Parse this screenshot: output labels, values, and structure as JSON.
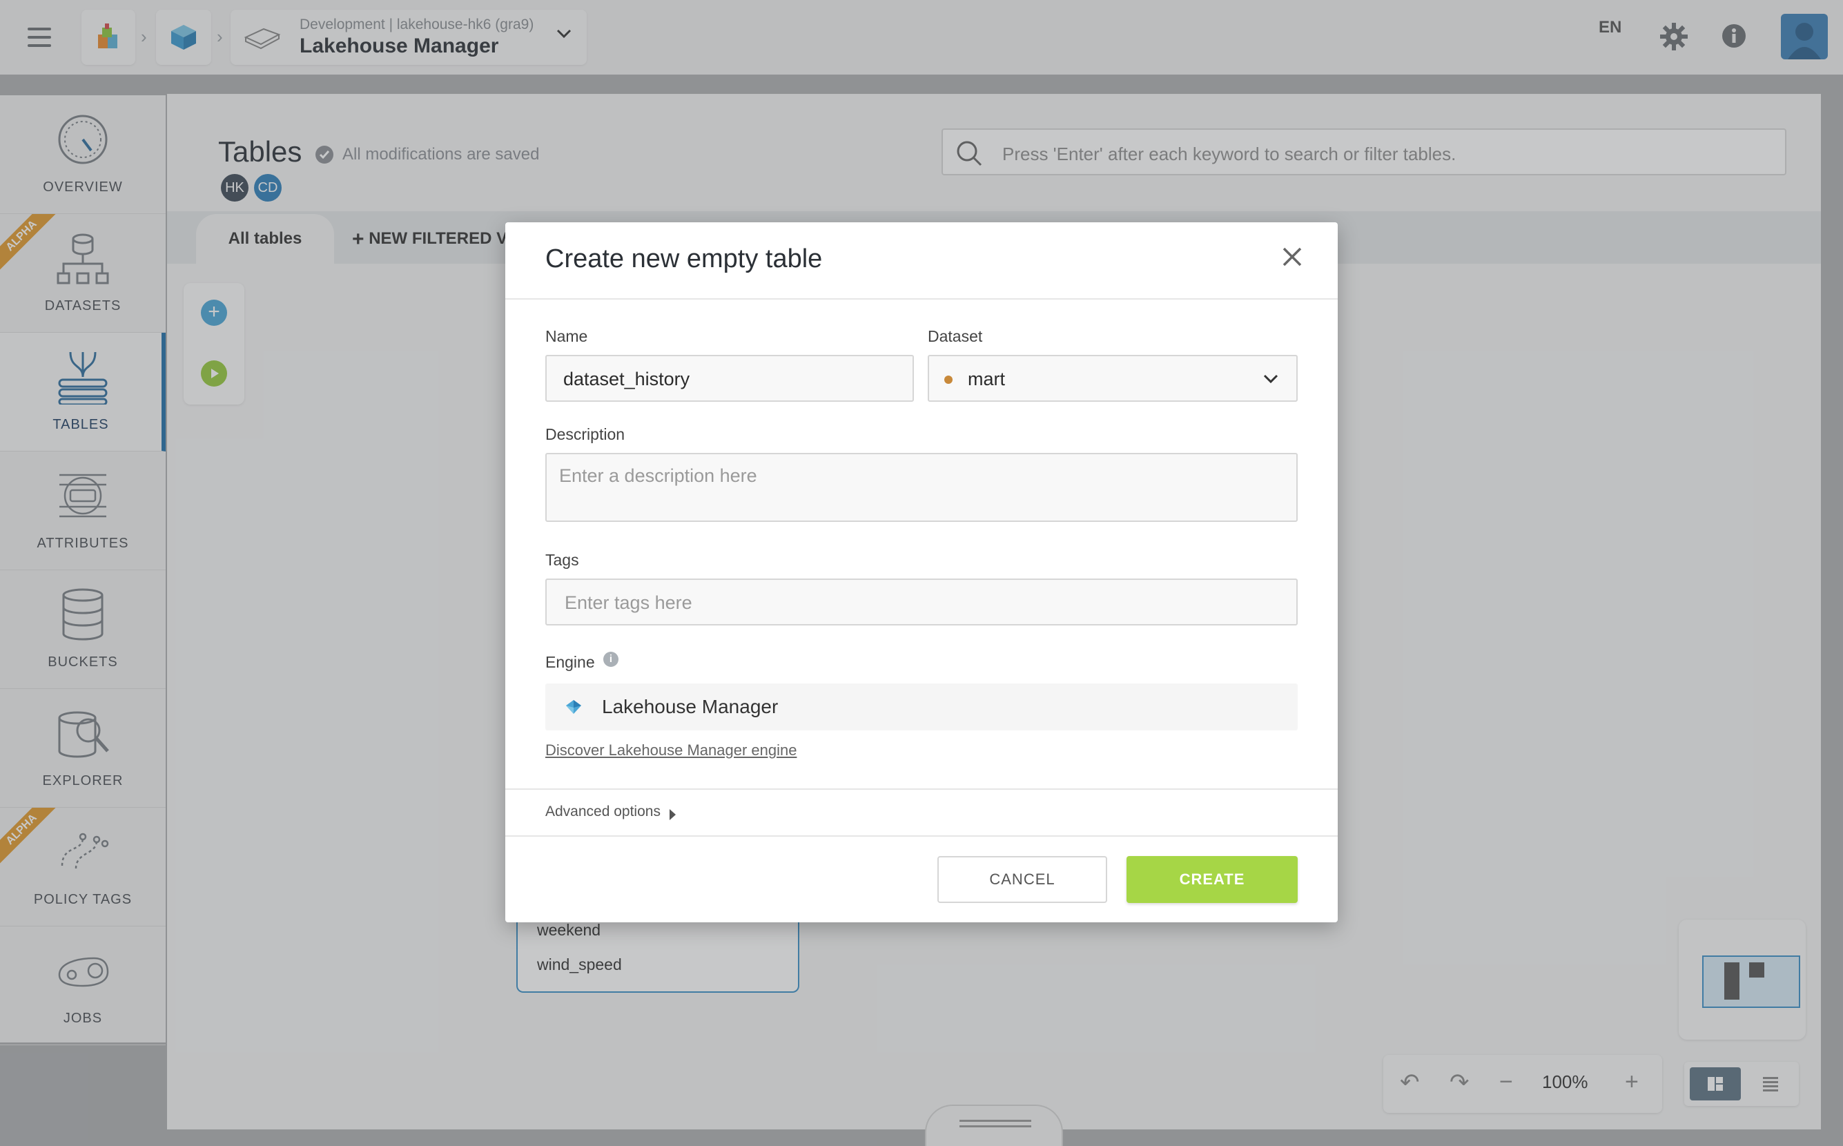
{
  "topbar": {
    "project_env": "Development",
    "project_id": "lakehouse-hk6 (gra9)",
    "app_title": "Lakehouse Manager",
    "language": "EN"
  },
  "sidebar": {
    "items": [
      {
        "label": "OVERVIEW",
        "badge": ""
      },
      {
        "label": "DATASETS",
        "badge": "ALPHA"
      },
      {
        "label": "TABLES",
        "badge": ""
      },
      {
        "label": "ATTRIBUTES",
        "badge": ""
      },
      {
        "label": "BUCKETS",
        "badge": ""
      },
      {
        "label": "EXPLORER",
        "badge": ""
      },
      {
        "label": "POLICY TAGS",
        "badge": "ALPHA"
      },
      {
        "label": "JOBS",
        "badge": ""
      }
    ],
    "active": "TABLES"
  },
  "page": {
    "title": "Tables",
    "saved_status": "All modifications are saved",
    "users": [
      "HK",
      "CD"
    ],
    "search_placeholder": "Press 'Enter' after each keyword to search or filter tables.",
    "tab_all": "All tables",
    "tab_new": "NEW FILTERED VI"
  },
  "canvas": {
    "node_fields": [
      "weekend",
      "wind_speed"
    ],
    "zoom": "100%"
  },
  "modal": {
    "title": "Create new empty table",
    "name_label": "Name",
    "name_value": "dataset_history",
    "dataset_label": "Dataset",
    "dataset_value": "mart",
    "description_label": "Description",
    "description_placeholder": "Enter a description here",
    "tags_label": "Tags",
    "tags_placeholder": "Enter tags here",
    "engine_label": "Engine",
    "engine_value": "Lakehouse Manager",
    "engine_link": "Discover Lakehouse Manager engine",
    "advanced_label": "Advanced options",
    "cancel_label": "CANCEL",
    "create_label": "CREATE"
  },
  "colors": {
    "accent_blue": "#1f6fa8",
    "create_green": "#a6d646",
    "alpha_orange": "#e19a2e",
    "dataset_dot": "#c8893a"
  }
}
